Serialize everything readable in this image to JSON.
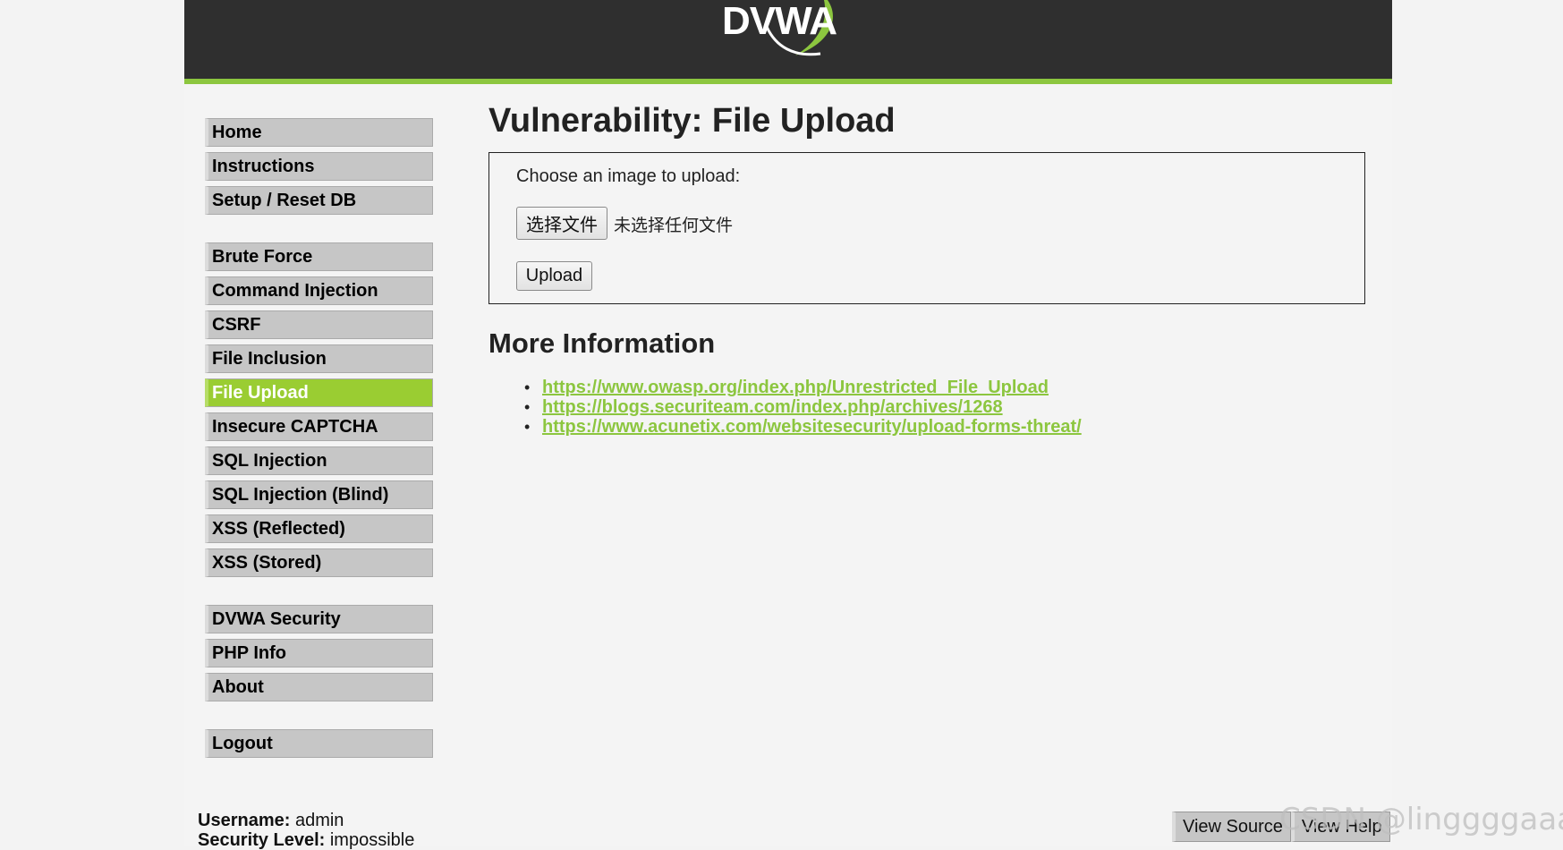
{
  "header": {
    "logo_text": "DVWA"
  },
  "sidebar": {
    "groups": [
      {
        "items": [
          "Home",
          "Instructions",
          "Setup / Reset DB"
        ]
      },
      {
        "items": [
          "Brute Force",
          "Command Injection",
          "CSRF",
          "File Inclusion",
          "File Upload",
          "Insecure CAPTCHA",
          "SQL Injection",
          "SQL Injection (Blind)",
          "XSS (Reflected)",
          "XSS (Stored)"
        ]
      },
      {
        "items": [
          "DVWA Security",
          "PHP Info",
          "About"
        ]
      },
      {
        "items": [
          "Logout"
        ]
      }
    ],
    "selected": "File Upload"
  },
  "main": {
    "title": "Vulnerability: File Upload",
    "upload_form": {
      "prompt": "Choose an image to upload:",
      "file_button_label": "选择文件",
      "file_status": "未选择任何文件",
      "upload_button_label": "Upload"
    },
    "more_info_heading": "More Information",
    "links": [
      "https://www.owasp.org/index.php/Unrestricted_File_Upload",
      "https://blogs.securiteam.com/index.php/archives/1268",
      "https://www.acunetix.com/websitesecurity/upload-forms-threat/"
    ]
  },
  "user_info": {
    "username_label": "Username:",
    "username": "admin",
    "security_label": "Security Level:",
    "security_level": "impossible"
  },
  "footer": {
    "view_source_label": "View Source",
    "view_help_label": "View Help"
  },
  "watermark": "CSDN @linggggaaaa",
  "colors": {
    "header_bg": "#2f2f2f",
    "accent_green": "#8cc63f",
    "selected_item": "#9acd32",
    "menu_item_bg": "#c6c6c6",
    "page_bg": "#f4f4f4"
  }
}
